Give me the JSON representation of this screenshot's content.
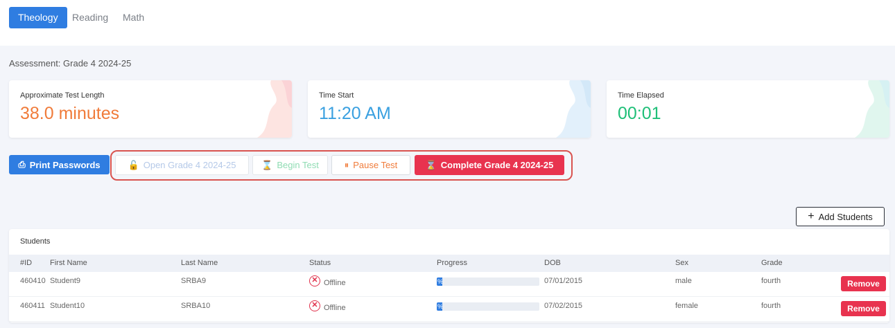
{
  "tabs": [
    {
      "label": "Theology",
      "active": true
    },
    {
      "label": "Reading",
      "active": false
    },
    {
      "label": "Math",
      "active": false
    }
  ],
  "assessment": "Assessment: Grade 4 2024-25",
  "cards": {
    "length": {
      "label": "Approximate Test Length",
      "value": "38.0 minutes",
      "color": "#f07b3a"
    },
    "start": {
      "label": "Time Start",
      "value": "11:20 AM",
      "color": "#3aa0e0"
    },
    "elapsed": {
      "label": "Time Elapsed",
      "value": "00:01",
      "color": "#1fbf78"
    }
  },
  "actions": {
    "print": "Print Passwords",
    "open": "Open Grade 4 2024-25",
    "begin": "Begin Test",
    "pause": "Pause Test",
    "complete": "Complete Grade 4 2024-25",
    "add": "Add Students"
  },
  "table": {
    "title": "Students",
    "columns": [
      "#ID",
      "First Name",
      "Last Name",
      "Status",
      "Progress",
      "DOB",
      "Sex",
      "Grade"
    ],
    "rows": [
      {
        "id": "460410",
        "first": "Student9",
        "last": "SRBA9",
        "status": "Offline",
        "progress": "%",
        "dob": "07/01/2015",
        "sex": "male",
        "grade": "fourth",
        "action": "Remove"
      },
      {
        "id": "460411",
        "first": "Student10",
        "last": "SRBA10",
        "status": "Offline",
        "progress": "%",
        "dob": "07/02/2015",
        "sex": "female",
        "grade": "fourth",
        "action": "Remove"
      }
    ]
  },
  "colors": {
    "primary": "#2f7de1",
    "danger": "#e8334f",
    "highlight": "#d9534f"
  }
}
